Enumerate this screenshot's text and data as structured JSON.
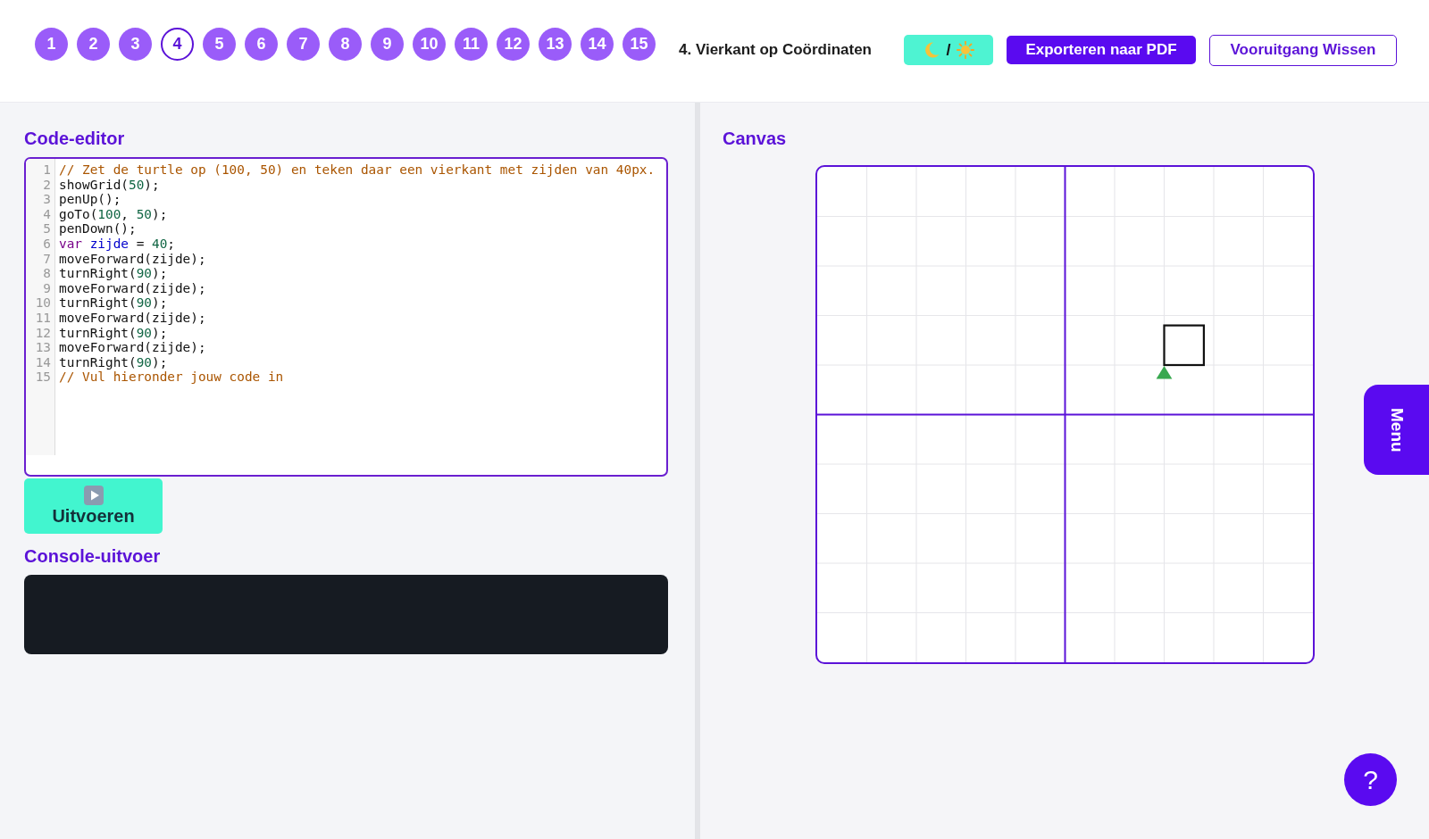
{
  "lesson_nav": {
    "items": [
      {
        "label": "1",
        "selected": false
      },
      {
        "label": "2",
        "selected": false
      },
      {
        "label": "3",
        "selected": false
      },
      {
        "label": "4",
        "selected": true
      },
      {
        "label": "5",
        "selected": false
      },
      {
        "label": "6",
        "selected": false
      },
      {
        "label": "7",
        "selected": false
      },
      {
        "label": "8",
        "selected": false
      },
      {
        "label": "9",
        "selected": false
      },
      {
        "label": "10",
        "selected": false
      },
      {
        "label": "11",
        "selected": false
      },
      {
        "label": "12",
        "selected": false
      },
      {
        "label": "13",
        "selected": false
      },
      {
        "label": "14",
        "selected": false
      },
      {
        "label": "15",
        "selected": false
      }
    ],
    "title": "4. Vierkant op Coördinaten"
  },
  "header_actions": {
    "theme_toggle": {
      "label": "/"
    },
    "export_button": {
      "label": "Exporteren naar PDF"
    },
    "reset_button": {
      "label": "Vooruitgang Wissen"
    }
  },
  "code_editor": {
    "title": "Code-editor",
    "lines": [
      {
        "number": "1",
        "tokens": [
          {
            "kind": "comment",
            "text": "// Zet de turtle op (100, 50) en teken daar een vierkant met zijden van 40px."
          }
        ]
      },
      {
        "number": "2",
        "tokens": [
          {
            "kind": "plain",
            "text": "showGrid("
          },
          {
            "kind": "number",
            "text": "50"
          },
          {
            "kind": "plain",
            "text": ");"
          }
        ]
      },
      {
        "number": "3",
        "tokens": [
          {
            "kind": "plain",
            "text": "penUp();"
          }
        ]
      },
      {
        "number": "4",
        "tokens": [
          {
            "kind": "plain",
            "text": "goTo("
          },
          {
            "kind": "number",
            "text": "100"
          },
          {
            "kind": "plain",
            "text": ", "
          },
          {
            "kind": "number",
            "text": "50"
          },
          {
            "kind": "plain",
            "text": ");"
          }
        ]
      },
      {
        "number": "5",
        "tokens": [
          {
            "kind": "plain",
            "text": "penDown();"
          }
        ]
      },
      {
        "number": "6",
        "tokens": [
          {
            "kind": "keyword",
            "text": "var"
          },
          {
            "kind": "def",
            "text": " zijde"
          },
          {
            "kind": "plain",
            "text": " = "
          },
          {
            "kind": "number",
            "text": "40"
          },
          {
            "kind": "plain",
            "text": ";"
          }
        ]
      },
      {
        "number": "7",
        "tokens": [
          {
            "kind": "plain",
            "text": "moveForward(zijde);"
          }
        ]
      },
      {
        "number": "8",
        "tokens": [
          {
            "kind": "plain",
            "text": "turnRight("
          },
          {
            "kind": "number",
            "text": "90"
          },
          {
            "kind": "plain",
            "text": ");"
          }
        ]
      },
      {
        "number": "9",
        "tokens": [
          {
            "kind": "plain",
            "text": "moveForward(zijde);"
          }
        ]
      },
      {
        "number": "10",
        "tokens": [
          {
            "kind": "plain",
            "text": "turnRight("
          },
          {
            "kind": "number",
            "text": "90"
          },
          {
            "kind": "plain",
            "text": ");"
          }
        ]
      },
      {
        "number": "11",
        "tokens": [
          {
            "kind": "plain",
            "text": "moveForward(zijde);"
          }
        ]
      },
      {
        "number": "12",
        "tokens": [
          {
            "kind": "plain",
            "text": "turnRight("
          },
          {
            "kind": "number",
            "text": "90"
          },
          {
            "kind": "plain",
            "text": ");"
          }
        ]
      },
      {
        "number": "13",
        "tokens": [
          {
            "kind": "plain",
            "text": "moveForward(zijde);"
          }
        ]
      },
      {
        "number": "14",
        "tokens": [
          {
            "kind": "plain",
            "text": "turnRight("
          },
          {
            "kind": "number",
            "text": "90"
          },
          {
            "kind": "plain",
            "text": ");"
          }
        ]
      },
      {
        "number": "15",
        "tokens": [
          {
            "kind": "comment",
            "text": "// Vul hieronder jouw code in"
          }
        ]
      }
    ]
  },
  "run_button": {
    "label": "Uitvoeren"
  },
  "console": {
    "title": "Console-uitvoer"
  },
  "canvas": {
    "title": "Canvas"
  },
  "side_menu": {
    "label": "Menu"
  },
  "help_button": {
    "label": "?"
  }
}
